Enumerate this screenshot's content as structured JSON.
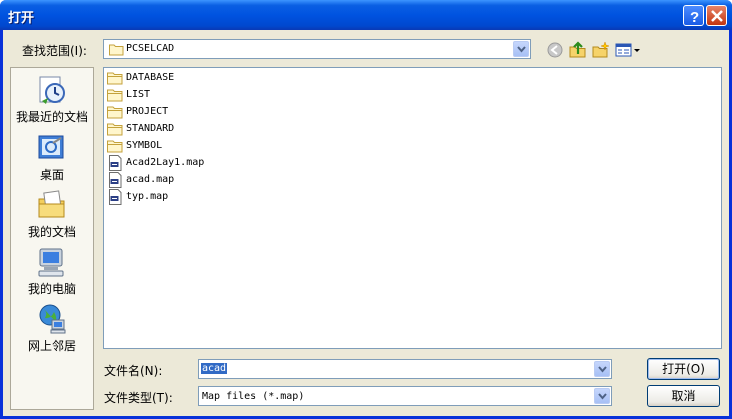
{
  "window": {
    "title": "打开"
  },
  "look_in": {
    "label": "查找范围(I):",
    "value": "PCSELCAD"
  },
  "toolbar": {
    "icons": [
      "back-icon",
      "up-folder-icon",
      "new-folder-icon",
      "view-menu-icon"
    ]
  },
  "places": [
    {
      "label": "我最近的文档",
      "icon": "recent-documents-icon"
    },
    {
      "label": "桌面",
      "icon": "desktop-icon"
    },
    {
      "label": "我的文档",
      "icon": "my-documents-icon"
    },
    {
      "label": "我的电脑",
      "icon": "my-computer-icon"
    },
    {
      "label": "网上邻居",
      "icon": "network-places-icon"
    }
  ],
  "files": [
    {
      "name": "DATABASE",
      "type": "folder"
    },
    {
      "name": "LIST",
      "type": "folder"
    },
    {
      "name": "PROJECT",
      "type": "folder"
    },
    {
      "name": "STANDARD",
      "type": "folder"
    },
    {
      "name": "SYMBOL",
      "type": "folder"
    },
    {
      "name": "Acad2Lay1.map",
      "type": "file"
    },
    {
      "name": "acad.map",
      "type": "file"
    },
    {
      "name": "typ.map",
      "type": "file"
    }
  ],
  "file_name": {
    "label": "文件名(N):",
    "value": "acad"
  },
  "file_type": {
    "label": "文件类型(T):",
    "value": "Map files (*.map)"
  },
  "buttons": {
    "open": "打开(O)",
    "cancel": "取消"
  },
  "colors": {
    "titlebar": "#0053e0",
    "dialog_bg": "#ece9d8",
    "selection": "#316ac5",
    "close_button": "#c23510"
  }
}
